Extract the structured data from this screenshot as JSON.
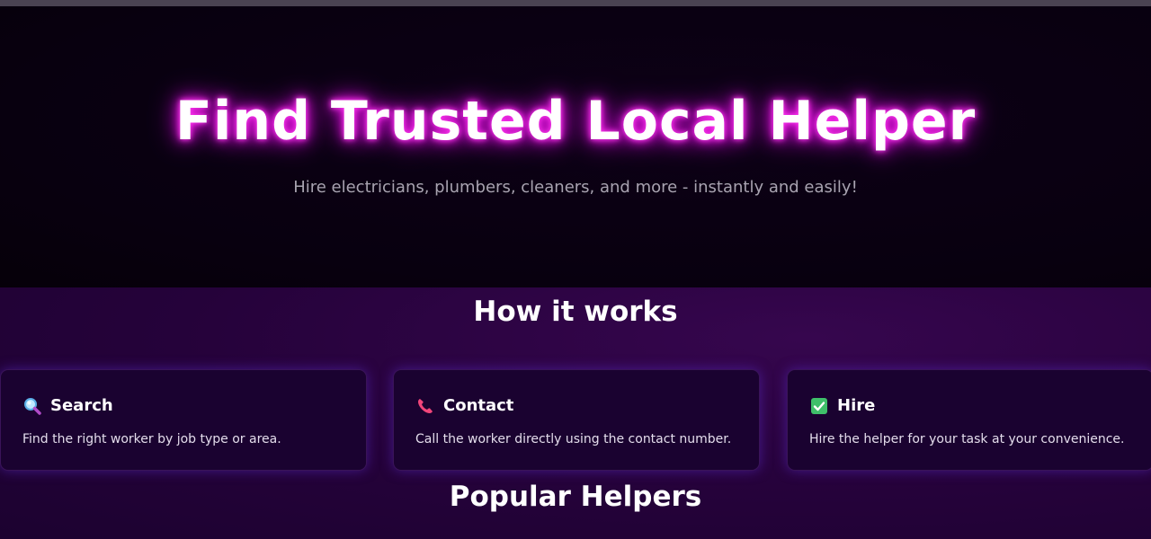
{
  "hero": {
    "title": "Find Trusted Local Helper",
    "subtitle": "Hire electricians, plumbers, cleaners, and more - instantly and easily!"
  },
  "how_it_works": {
    "heading": "How it works",
    "cards": [
      {
        "icon": "magnifier-icon",
        "title": "Search",
        "description": "Find the right worker by job type or area."
      },
      {
        "icon": "phone-icon",
        "title": "Contact",
        "description": "Call the worker directly using the contact number."
      },
      {
        "icon": "check-mark-icon",
        "title": "Hire",
        "description": "Hire the helper for your task at your convenience."
      }
    ]
  },
  "popular": {
    "heading": "Popular Helpers"
  },
  "colors": {
    "hero_background": "#08000f",
    "section_background": "#25023a",
    "card_background": "#1a0230",
    "title_glow": "#ff22ee",
    "subtitle_text": "#a8a3b0"
  }
}
